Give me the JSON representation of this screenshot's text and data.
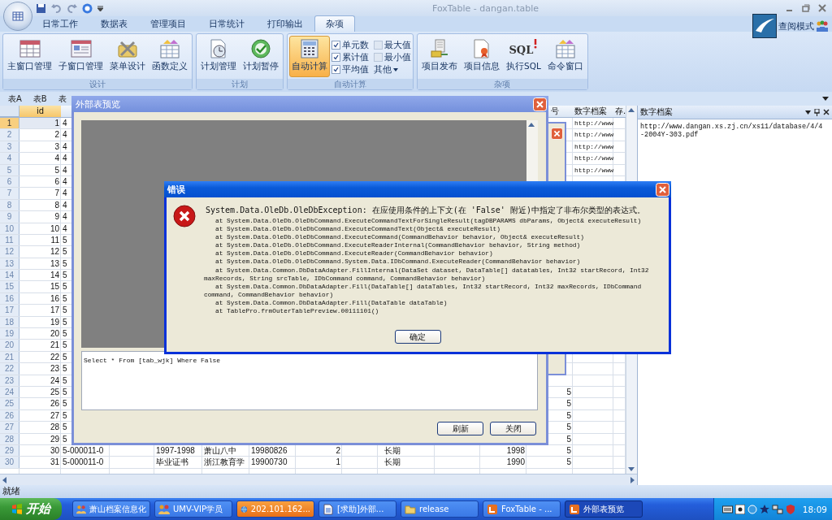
{
  "window": {
    "title": "FoxTable - dangan.table"
  },
  "ribbon": {
    "tabs": [
      {
        "label": "日常工作",
        "selected": false
      },
      {
        "label": "数据表",
        "selected": false
      },
      {
        "label": "管理项目",
        "selected": false
      },
      {
        "label": "日常统计",
        "selected": false
      },
      {
        "label": "打印输出",
        "selected": false
      },
      {
        "label": "杂项",
        "selected": true
      }
    ],
    "mode_label": "查阅模式",
    "groups": [
      {
        "title": "设计",
        "items": [
          {
            "kind": "large",
            "label": "主窗口管理"
          },
          {
            "kind": "large",
            "label": "子窗口管理"
          },
          {
            "kind": "large",
            "label": "菜单设计"
          },
          {
            "kind": "large",
            "label": "函数定义"
          }
        ]
      },
      {
        "title": "计划",
        "items": [
          {
            "kind": "large",
            "label": "计划管理"
          },
          {
            "kind": "large",
            "label": "计划暂停"
          }
        ]
      },
      {
        "title": "自动计算",
        "items": [
          {
            "kind": "toggle",
            "label": "自动计算",
            "on": true
          },
          {
            "kind": "options",
            "options": [
              {
                "kind": "check",
                "label": "单元数",
                "checked": true
              },
              {
                "kind": "check",
                "label": "累计值",
                "checked": true
              },
              {
                "kind": "check",
                "label": "平均值",
                "checked": true
              },
              {
                "kind": "check",
                "label": "最大值",
                "checked": false
              },
              {
                "kind": "check",
                "label": "最小值",
                "checked": false
              },
              {
                "kind": "menu",
                "label": "其他"
              }
            ]
          }
        ]
      },
      {
        "title": "杂项",
        "items": [
          {
            "kind": "large",
            "label": "项目发布"
          },
          {
            "kind": "large",
            "label": "项目信息"
          },
          {
            "kind": "text_icon",
            "icon_text": "SQL",
            "label": "执行SQL"
          },
          {
            "kind": "large",
            "label": "命令窗口"
          }
        ]
      }
    ]
  },
  "sheet_tabs": [
    {
      "label": "表A"
    },
    {
      "label": "表B"
    },
    {
      "label": "表"
    }
  ],
  "grid": {
    "header": {
      "id": "id",
      "column_12": "号",
      "column_13": "数字档案",
      "column_14": "存."
    },
    "rows": [
      {
        "number": "1",
        "selected": true,
        "id": "1",
        "column_2": "4",
        "column_13": "http://www"
      },
      {
        "number": "2",
        "selected": false,
        "id": "2",
        "column_2": "4",
        "column_13": "http://www"
      },
      {
        "number": "3",
        "selected": false,
        "id": "3",
        "column_2": "4",
        "column_13": "http://www"
      },
      {
        "number": "4",
        "selected": false,
        "id": "4",
        "column_2": "4",
        "column_13": "http://www"
      },
      {
        "number": "5",
        "selected": false,
        "id": "5",
        "column_2": "4",
        "column_13": "http://www"
      },
      {
        "number": "6",
        "selected": false,
        "id": "6",
        "column_2": "4"
      },
      {
        "number": "7",
        "selected": false,
        "id": "7",
        "column_2": "4"
      },
      {
        "number": "8",
        "selected": false,
        "id": "8",
        "column_2": "4"
      },
      {
        "number": "9",
        "selected": false,
        "id": "9",
        "column_2": "4"
      },
      {
        "number": "10",
        "selected": false,
        "id": "10",
        "column_2": "4"
      },
      {
        "number": "11",
        "selected": false,
        "id": "11",
        "column_2": "5"
      },
      {
        "number": "12",
        "selected": false,
        "id": "12",
        "column_2": "5"
      },
      {
        "number": "13",
        "selected": false,
        "id": "13",
        "column_2": "5"
      },
      {
        "number": "14",
        "selected": false,
        "id": "14",
        "column_2": "5"
      },
      {
        "number": "15",
        "selected": false,
        "id": "15",
        "column_2": "5"
      },
      {
        "number": "16",
        "selected": false,
        "id": "16",
        "column_2": "5"
      },
      {
        "number": "17",
        "selected": false,
        "id": "17",
        "column_2": "5"
      },
      {
        "number": "18",
        "selected": false,
        "id": "19",
        "column_2": "5"
      },
      {
        "number": "19",
        "selected": false,
        "id": "20",
        "column_2": "5"
      },
      {
        "number": "20",
        "selected": false,
        "id": "21",
        "column_2": "5"
      },
      {
        "number": "21",
        "selected": false,
        "id": "22",
        "column_2": "5"
      },
      {
        "number": "22",
        "selected": false,
        "id": "23",
        "column_2": "5"
      },
      {
        "number": "23",
        "selected": false,
        "id": "24",
        "column_2": "5"
      },
      {
        "number": "24",
        "selected": false,
        "id": "25",
        "column_2": "5",
        "column_12": "5"
      },
      {
        "number": "25",
        "selected": false,
        "id": "26",
        "column_2": "5",
        "column_12": "5"
      },
      {
        "number": "26",
        "selected": false,
        "id": "27",
        "column_2": "5",
        "column_12": "5"
      },
      {
        "number": "27",
        "selected": false,
        "id": "28",
        "column_2": "5",
        "column_12": "5"
      },
      {
        "number": "28",
        "selected": false,
        "id": "29",
        "column_2": "5",
        "column_12": "5"
      },
      {
        "number": "29",
        "selected": false,
        "id": "30",
        "column_2": "5-000011-0",
        "column_4": "1997-1998",
        "column_5": "萧山八中",
        "column_6": "19980826",
        "column_7": "2",
        "column_9": "长期",
        "column_11": "1998",
        "column_12": "5"
      },
      {
        "number": "30",
        "selected": false,
        "id": "31",
        "column_2": "5-000011-0",
        "column_4": "毕业证书",
        "column_5": "浙江教育学",
        "column_6": "19900730",
        "column_7": "1",
        "column_9": "长期",
        "column_11": "1990",
        "column_12": "5"
      }
    ]
  },
  "side_panel": {
    "title": "数字档案",
    "text": "http://www.dangan.xs.zj.cn/xs11/database/4/4-2004Y-303.pdf"
  },
  "status_bar": {
    "text": "就绪"
  },
  "preview_dialog": {
    "title": "外部表预览",
    "query": "Select * From [tab_wjk] Where False",
    "buttons": [
      "刷新",
      "关闭"
    ]
  },
  "error_dialog": {
    "title": "错误",
    "message": "System.Data.OleDb.OleDbException: 在应使用条件的上下文(在 'False' 附近)中指定了非布尔类型的表达式。",
    "trace": "   at System.Data.OleDb.OleDbCommand.ExecuteCommandTextForSingleResult(tagDBPARAMS dbParams, Object& executeResult)\n   at System.Data.OleDb.OleDbCommand.ExecuteCommandText(Object& executeResult)\n   at System.Data.OleDb.OleDbCommand.ExecuteCommand(CommandBehavior behavior, Object& executeResult)\n   at System.Data.OleDb.OleDbCommand.ExecuteReaderInternal(CommandBehavior behavior, String method)\n   at System.Data.OleDb.OleDbCommand.ExecuteReader(CommandBehavior behavior)\n   at System.Data.OleDb.OleDbCommand.System.Data.IDbCommand.ExecuteReader(CommandBehavior behavior)\n   at System.Data.Common.DbDataAdapter.FillInternal(DataSet dataset, DataTable[] datatables, Int32 startRecord, Int32 maxRecords, String srcTable, IDbCommand command, CommandBehavior behavior)\n   at System.Data.Common.DbDataAdapter.Fill(DataTable[] dataTables, Int32 startRecord, Int32 maxRecords, IDbCommand command, CommandBehavior behavior)\n   at System.Data.Common.DbDataAdapter.Fill(DataTable dataTable)\n   at TablePro.frmOuterTablePreview.00111101()",
    "button": "确定"
  },
  "taskbar": {
    "start": "开始",
    "clock": "18:09",
    "items": [
      {
        "label": "萧山档案信息化",
        "selected": false,
        "highlighted": false
      },
      {
        "label": "UMV-VIP学员",
        "selected": false,
        "highlighted": false
      },
      {
        "label": "202.101.162...",
        "selected": false,
        "highlighted": true
      },
      {
        "label": "[求助]外部...",
        "selected": false,
        "highlighted": false
      },
      {
        "label": "release",
        "selected": false,
        "highlighted": false
      },
      {
        "label": "FoxTable - ...",
        "selected": false,
        "highlighted": false
      },
      {
        "label": "外部表预览",
        "selected": true,
        "highlighted": false
      }
    ]
  }
}
